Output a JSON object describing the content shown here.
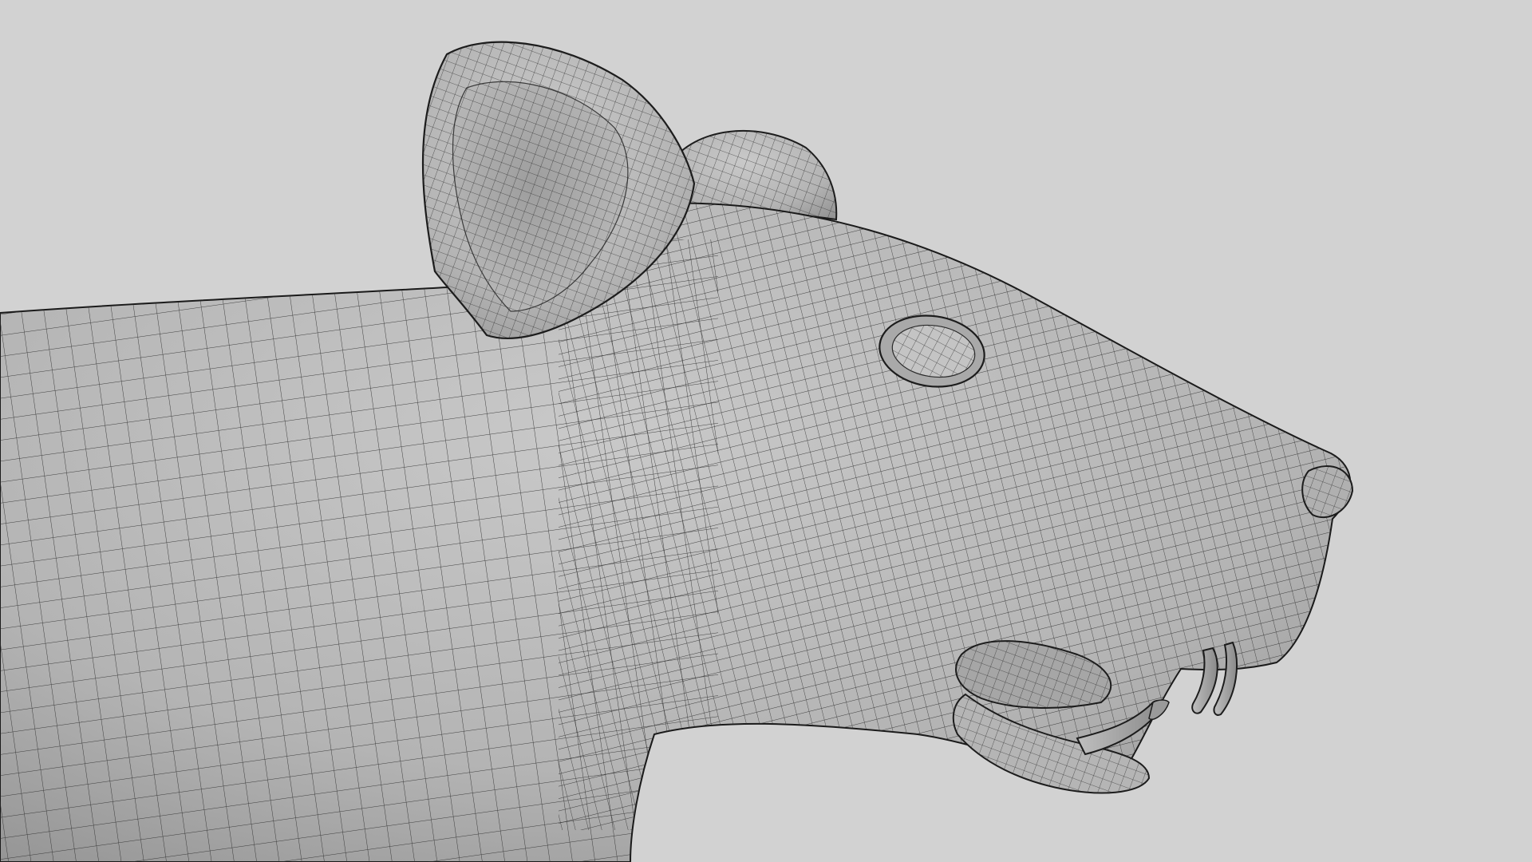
{
  "viewport": {
    "background_color": "#d2d2d2",
    "mesh_fill_color": "#b8b8b8",
    "wire_color": "#2a2a2a",
    "subject": "rat-head-wireframe-mesh"
  }
}
